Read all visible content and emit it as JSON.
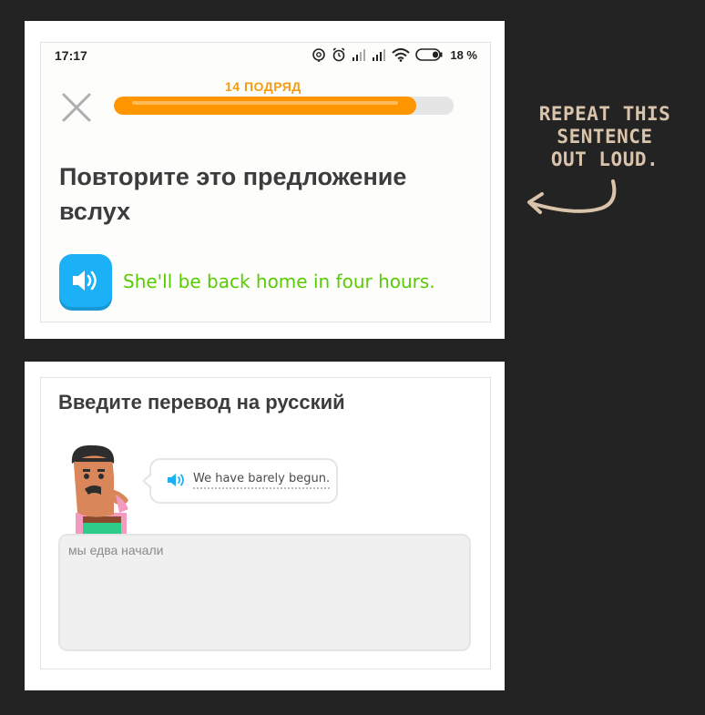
{
  "card1": {
    "status_bar": {
      "time": "17:17",
      "battery": "18 %",
      "icons": [
        "alarm-icon",
        "clock-alarm-icon",
        "signal-icon",
        "signal-icon",
        "wifi-icon",
        "battery-icon"
      ]
    },
    "streak_label": "14 ПОДРЯД",
    "progress": 0.89,
    "close_icon": "close-icon",
    "instruction": "Повторите это предложение вслух",
    "sentence": "She'll be back home in four hours.",
    "speaker_icon": "speaker-icon"
  },
  "card2": {
    "instruction": "Введите перевод на русский",
    "bubble_text": "We have barely begun.",
    "answer_text": "мы едва начали"
  },
  "annotation": {
    "lines": [
      "REPEAT THIS",
      "SENTENCE",
      "OUT LOUD."
    ]
  },
  "colors": {
    "background": "#232323",
    "progress": "#ff9600",
    "streak": "#f39c12",
    "speaker_button": "#1cb0f6",
    "sentence": "#58cc02",
    "annotation": "#d9c3aa"
  }
}
